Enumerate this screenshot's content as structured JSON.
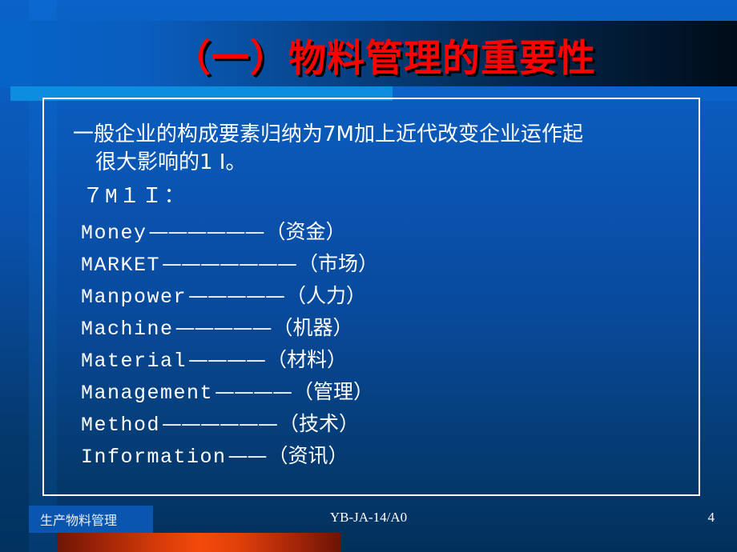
{
  "slide": {
    "title": "（一）物料管理的重要性",
    "decorative_faint_text": "· · · · · · · · · · · · · · · · · · · · · ·",
    "accent_color": "#0d8ddd",
    "title_color": "#ff0000",
    "background_top_color": "#0a63c8",
    "background_bottom_color": "#02305c"
  },
  "body": {
    "lead_line1": "一般企业的构成要素归纳为7M加上近代改变企业运作起",
    "lead_line2": "很大影响的1 I。",
    "subhead": "７M１Ｉ：",
    "items": [
      {
        "term": "Money",
        "dash": "——————",
        "cn": "（资金）"
      },
      {
        "term": "MARKET",
        "dash": "———————",
        "cn": "（市场）"
      },
      {
        "term": "Manpower",
        "dash": "—————",
        "cn": "（人力）"
      },
      {
        "term": "Machine",
        "dash": "—————",
        "cn": "（机器）"
      },
      {
        "term": "Material",
        "dash": "————",
        "cn": "（材料）"
      },
      {
        "term": "Management",
        "dash": "————",
        "cn": "（管理）"
      },
      {
        "term": "Method",
        "dash": "——————",
        "cn": "（技术）"
      },
      {
        "term": "Information",
        "dash": "——",
        "cn": "（资讯）"
      }
    ]
  },
  "footer": {
    "left": "生产物料管理",
    "center": "YB-JA-14/A0",
    "page": "4",
    "bar_color": "#f44a0b"
  }
}
